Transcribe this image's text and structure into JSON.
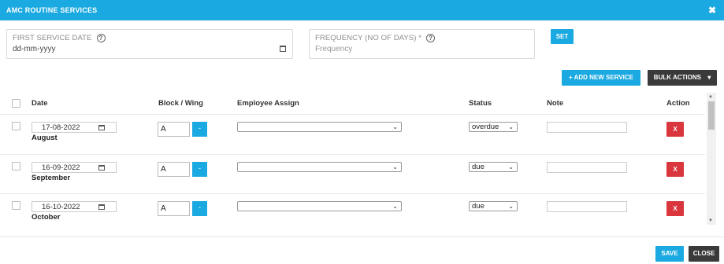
{
  "modal": {
    "title": "AMC ROUTINE SERVICES",
    "close_glyph": "✖"
  },
  "form": {
    "first_service_date": {
      "label": "FIRST SERVICE DATE",
      "value": "dd-mm-yyyy"
    },
    "frequency": {
      "label": "FREQUENCY (NO OF DAYS) *",
      "placeholder": "Frequency"
    },
    "set_label": "SET",
    "help_glyph": "?"
  },
  "toolbar": {
    "add_new_service_label": "+ ADD NEW SERVICE",
    "bulk_actions_label": "BULK ACTIONS",
    "bulk_caret": "▾"
  },
  "table": {
    "columns": [
      "Date",
      "Block / Wing",
      "Employee Assign",
      "Status",
      "Note",
      "Action"
    ],
    "rows": [
      {
        "date": "17-08-2022",
        "month": "August",
        "block": "A",
        "minus": "-",
        "employee": "",
        "status": "overdue",
        "note": "",
        "action": "X"
      },
      {
        "date": "16-09-2022",
        "month": "September",
        "block": "A",
        "minus": "-",
        "employee": "",
        "status": "due",
        "note": "",
        "action": "X"
      },
      {
        "date": "16-10-2022",
        "month": "October",
        "block": "A",
        "minus": "-",
        "employee": "",
        "status": "due",
        "note": "",
        "action": "X"
      }
    ],
    "select_chevron": "⌄"
  },
  "footer": {
    "save_label": "SAVE",
    "close_label": "CLOSE"
  },
  "colors": {
    "accent": "#1aa9e0",
    "danger": "#d9363e",
    "dark": "#3a3a3a"
  },
  "scroll_glyphs": {
    "up": "▲",
    "down": "▼"
  }
}
